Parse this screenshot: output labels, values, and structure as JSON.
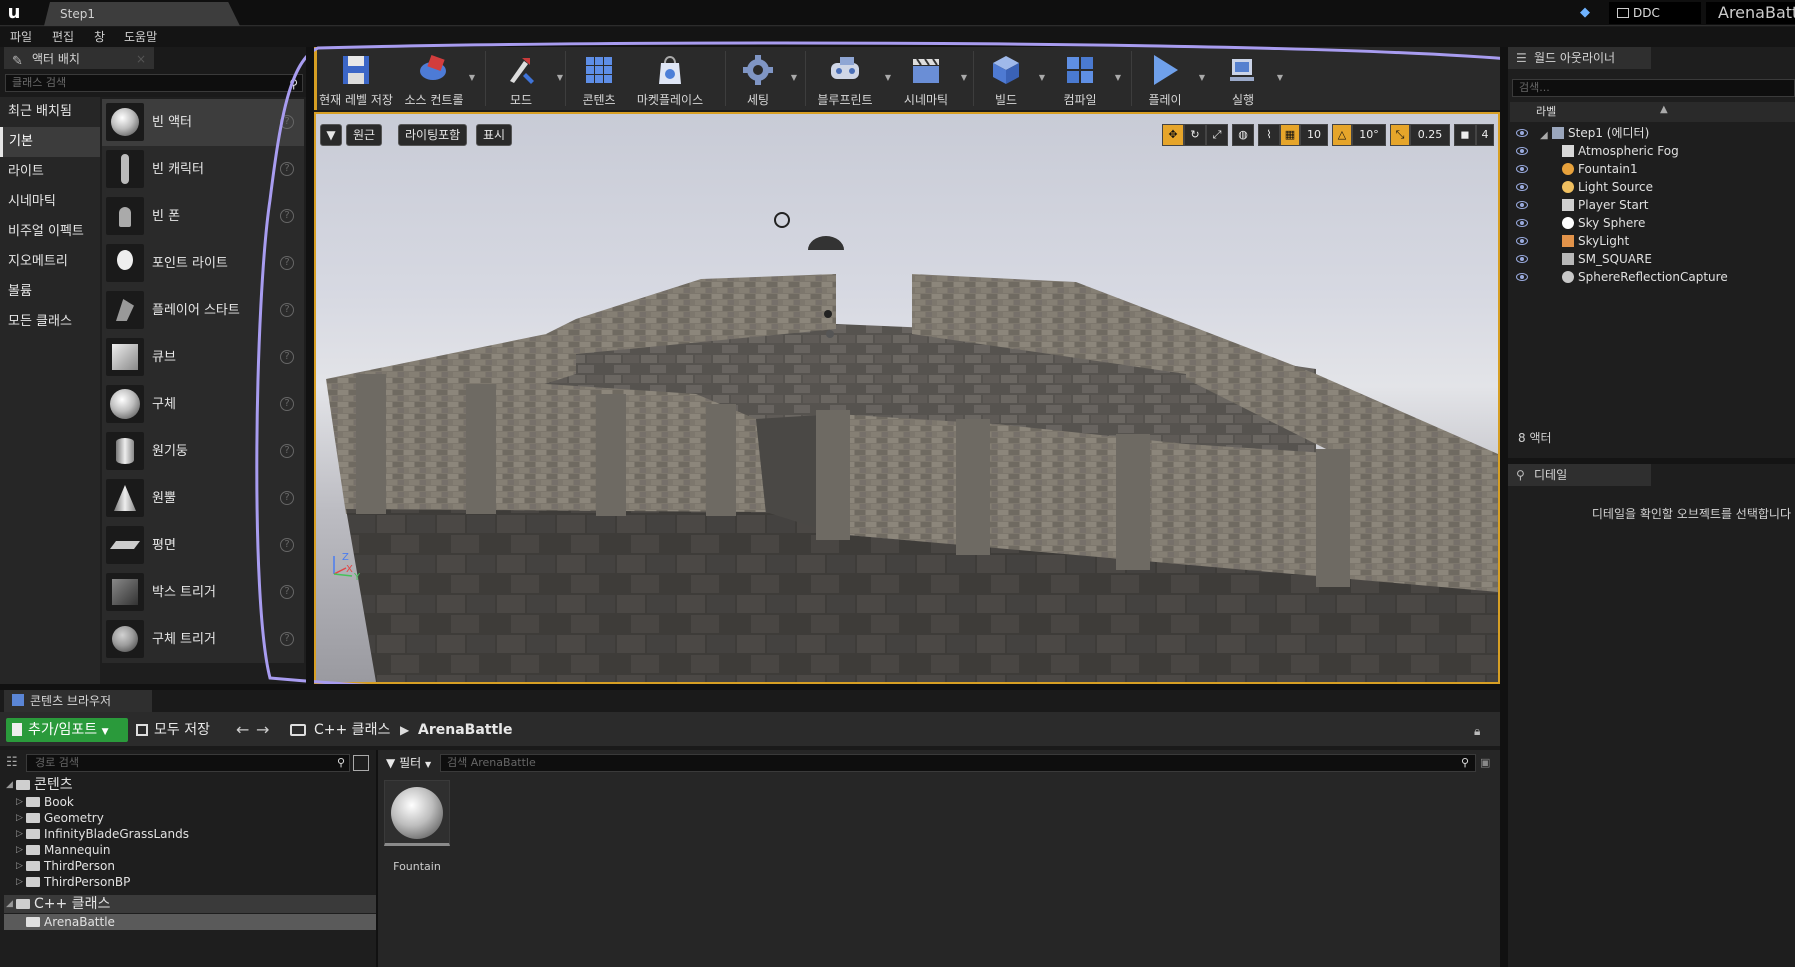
{
  "titlebar": {
    "doc_tab": "Step1",
    "ddc": "DDC",
    "project": "ArenaBattle"
  },
  "menu": [
    "파일",
    "편집",
    "창",
    "도움말"
  ],
  "modes": {
    "tab_label": "액터 배치",
    "search_placeholder": "클래스 검색",
    "categories": [
      "최근 배치됨",
      "기본",
      "라이트",
      "시네마틱",
      "비주얼 이펙트",
      "지오메트리",
      "볼륨",
      "모든 클래스"
    ],
    "active_category": "기본",
    "items": [
      "빈 액터",
      "빈 캐릭터",
      "빈 폰",
      "포인트 라이트",
      "플레이어 스타트",
      "큐브",
      "구체",
      "원기둥",
      "원뿔",
      "평면",
      "박스 트리거",
      "구체 트리거"
    ],
    "help_glyph": "?"
  },
  "toolbar": {
    "buttons": [
      "현재 레벨 저장",
      "소스 컨트롤",
      "모드",
      "콘텐츠",
      "마켓플레이스",
      "세팅",
      "블루프린트",
      "시네마틱",
      "빌드",
      "컴파일",
      "플레이",
      "실행"
    ]
  },
  "viewport": {
    "perspective": "원근",
    "lighting": "라이팅포함",
    "show": "표시",
    "grid_snap": "10",
    "rot_snap": "10°",
    "scale_snap": "0.25",
    "cam_speed": "4",
    "axis_labels": [
      "Z",
      "X",
      "Y"
    ]
  },
  "outliner": {
    "tab_label": "월드 아웃라이너",
    "search_placeholder": "검색...",
    "column": "라벨",
    "rows": [
      "Step1 (에디터)",
      "Atmospheric Fog",
      "Fountain1",
      "Light Source",
      "Player Start",
      "Sky Sphere",
      "SkyLight",
      "SM_SQUARE",
      "SphereReflectionCapture"
    ],
    "count": "8 액터"
  },
  "details": {
    "tab_label": "디테일",
    "message": "디테일을 확인할 오브젝트를 선택합니다"
  },
  "content_browser": {
    "tab_label": "콘텐츠 브라우저",
    "add_import": "추가/임포트",
    "save_all": "모두 저장",
    "crumb_root": "C++ 클래스",
    "crumb_sep": "▶",
    "crumb_current": "ArenaBattle",
    "path_search_placeholder": "경로 검색",
    "tree": {
      "content_root": "콘텐츠",
      "content_folders": [
        "Book",
        "Geometry",
        "InfinityBladeGrassLands",
        "Mannequin",
        "ThirdPerson",
        "ThirdPersonBP"
      ],
      "cpp_root": "C++ 클래스",
      "cpp_folders": [
        "ArenaBattle"
      ]
    },
    "filter": "필터",
    "asset_search_placeholder": "검색 ArenaBattle",
    "assets": [
      "Fountain"
    ]
  },
  "colors": {
    "accent_orange": "#d79f24",
    "add_green": "#2a9a3b",
    "annotation_purple": "#a89cf0"
  }
}
